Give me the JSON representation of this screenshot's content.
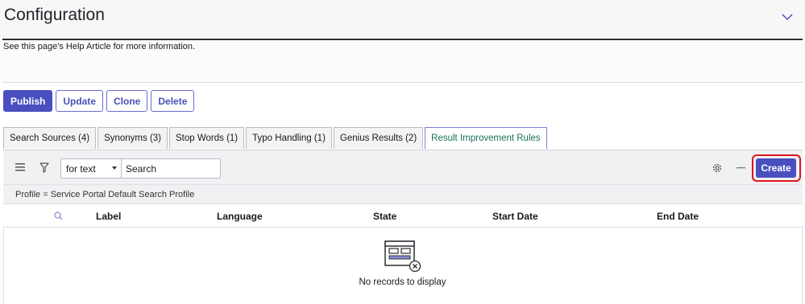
{
  "header": {
    "title": "Configuration",
    "collapse_icon": "chevron-down-icon",
    "help_text": "See this page's Help Article for more information."
  },
  "actions": {
    "publish": "Publish",
    "update": "Update",
    "clone": "Clone",
    "delete": "Delete"
  },
  "tabs": [
    {
      "label": "Search Sources (4)",
      "active": false
    },
    {
      "label": "Synonyms (3)",
      "active": false
    },
    {
      "label": "Stop Words (1)",
      "active": false
    },
    {
      "label": "Typo Handling (1)",
      "active": false
    },
    {
      "label": "Genius Results (2)",
      "active": false
    },
    {
      "label": "Result Improvement Rules",
      "active": true
    }
  ],
  "toolbar": {
    "menu_icon": "hamburger-menu-icon",
    "filter_icon": "filter-funnel-icon",
    "search_field_select": "for text",
    "search_placeholder": "Search",
    "settings_icon": "gear-icon",
    "collapse_icon": "minus-icon",
    "create_label": "Create"
  },
  "filter": {
    "condition": "Profile = Service Portal Default Search Profile"
  },
  "table": {
    "search_icon": "search-icon",
    "columns": [
      "Label",
      "Language",
      "State",
      "Start Date",
      "End Date"
    ],
    "rows": [],
    "empty_message": "No records to display",
    "empty_icon": "empty-records-icon"
  },
  "colors": {
    "primary": "#4a4fc0",
    "active_tab_text": "#17705c",
    "highlight": "#e0141b"
  }
}
